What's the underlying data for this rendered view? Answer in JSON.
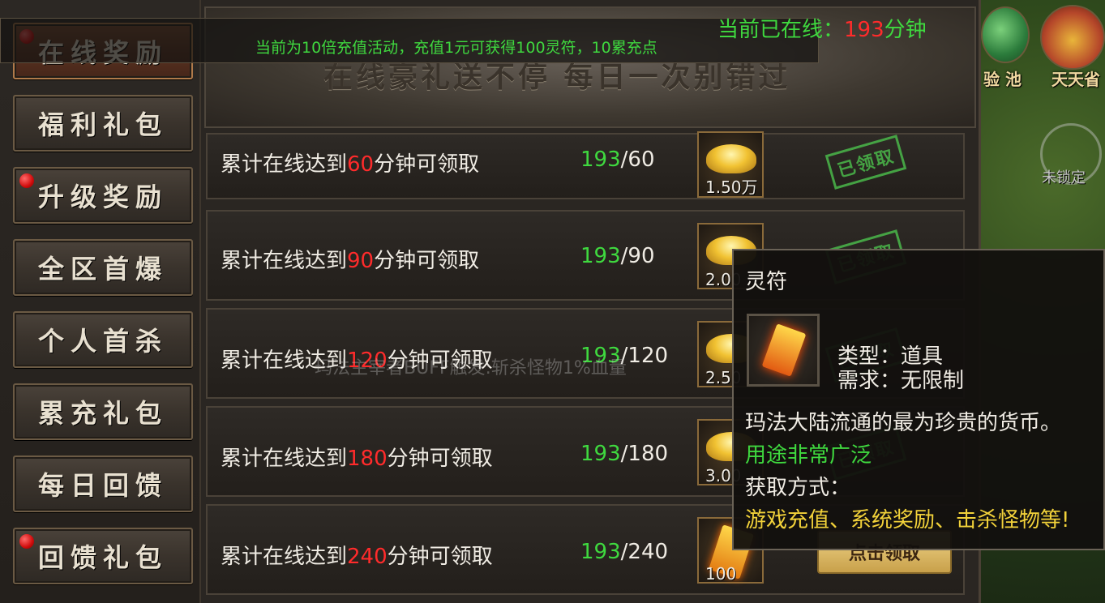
{
  "scenery": {
    "label_left": "验 池",
    "label_right": "天天省",
    "lock_label": "未锁定"
  },
  "sidebar": {
    "items": [
      {
        "label": "在线奖励",
        "dot": true,
        "active": true
      },
      {
        "label": "福利礼包",
        "dot": false,
        "active": false
      },
      {
        "label": "升级奖励",
        "dot": true,
        "active": false
      },
      {
        "label": "全区首爆",
        "dot": false,
        "active": false
      },
      {
        "label": "个人首杀",
        "dot": false,
        "active": false
      },
      {
        "label": "累充礼包",
        "dot": false,
        "active": false
      },
      {
        "label": "每日回馈",
        "dot": false,
        "active": false
      },
      {
        "label": "回馈礼包",
        "dot": true,
        "active": false
      }
    ]
  },
  "banner": {
    "title": "在线豪礼送不停 每日一次别错过",
    "notice": "当前为10倍充值活动，充值1元可获得100灵符，10累充点",
    "online_prefix": "当前已在线：",
    "online_minutes": "193",
    "online_suffix": "分钟"
  },
  "combat_text": "玛法主宰者BUFF触发:斩杀怪物1%血量",
  "rewards": {
    "req_prefix": "累计在线达到",
    "req_suffix": "分钟可领取",
    "current": "193",
    "claimed_label": "已领取",
    "claim_button": "点击领取",
    "rows": [
      {
        "minutes": "60",
        "target": "/60",
        "qty": "1.50万",
        "item": "gold-ingot",
        "claimed": true
      },
      {
        "minutes": "90",
        "target": "/90",
        "qty": "2.00",
        "item": "gold-ingot",
        "claimed": true
      },
      {
        "minutes": "120",
        "target": "/120",
        "qty": "2.50",
        "item": "gold-ingot",
        "claimed": true
      },
      {
        "minutes": "180",
        "target": "/180",
        "qty": "3.00",
        "item": "gold-ingot",
        "claimed": true
      },
      {
        "minutes": "240",
        "target": "/240",
        "qty": "100",
        "item": "talisman",
        "claimed": false
      }
    ]
  },
  "tooltip": {
    "name": "灵符",
    "type_line": "类型：道具",
    "req_line": "需求：无限制",
    "desc": "玛法大陆流通的最为珍贵的货币。",
    "usage": "用途非常广泛",
    "source_title": "获取方式：",
    "source": "游戏充值、系统奖励、击杀怪物等!"
  },
  "colors": {
    "highlight_red": "#ff2b2b",
    "highlight_green": "#3fd93f",
    "highlight_yellow": "#f2d23a"
  }
}
